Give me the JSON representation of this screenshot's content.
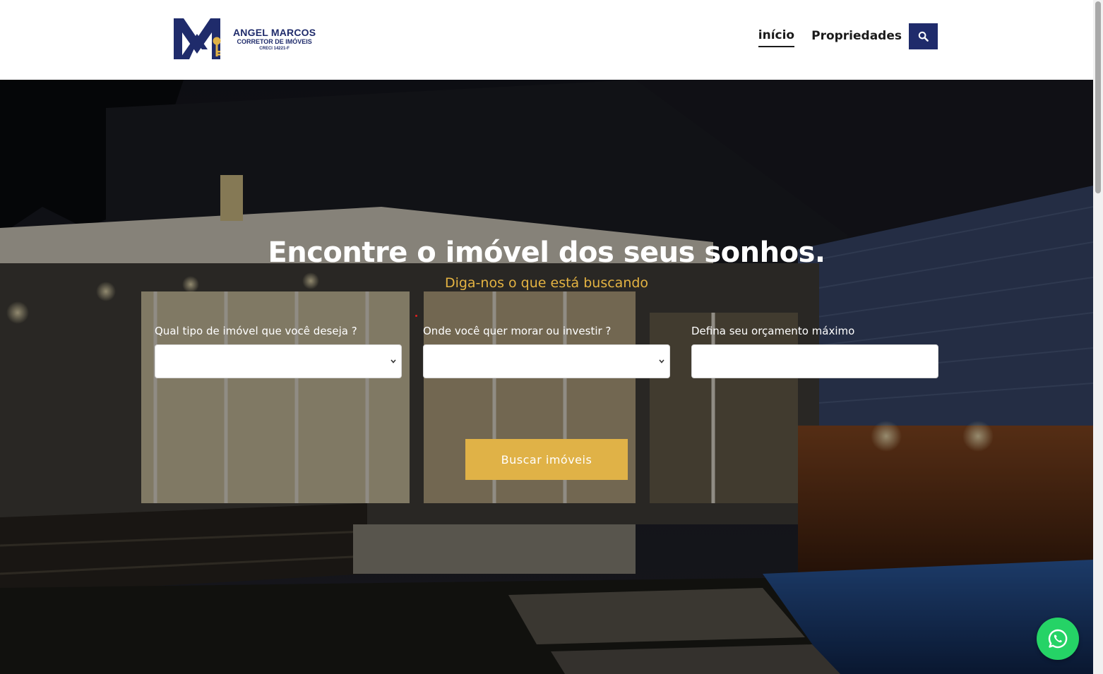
{
  "logo": {
    "name": "ANGEL MARCOS",
    "subtitle": "CORRETOR DE IMÓVEIS",
    "creci": "CRECI 14221-F",
    "icon": "key-icon"
  },
  "nav": {
    "items": [
      {
        "label": "início",
        "active": true
      },
      {
        "label": "Propriedades",
        "active": false
      }
    ],
    "search_icon": "search-icon"
  },
  "hero": {
    "title": "Encontre o imóvel dos seus sonhos.",
    "subtitle": "Diga-nos o que está buscando"
  },
  "form": {
    "property_type": {
      "label": "Qual tipo de imóvel que você deseja ?",
      "value": ""
    },
    "location": {
      "label": "Onde você quer morar ou investir ?",
      "value": ""
    },
    "budget": {
      "label": "Defina seu orçamento máximo",
      "value": ""
    },
    "submit_label": "Buscar imóveis"
  },
  "whatsapp": {
    "icon": "whatsapp-icon"
  },
  "colors": {
    "brand_navy": "#1f2b6b",
    "accent_gold": "#e0b247",
    "subtitle_gold": "#e4b342",
    "whatsapp_green": "#25d366"
  }
}
